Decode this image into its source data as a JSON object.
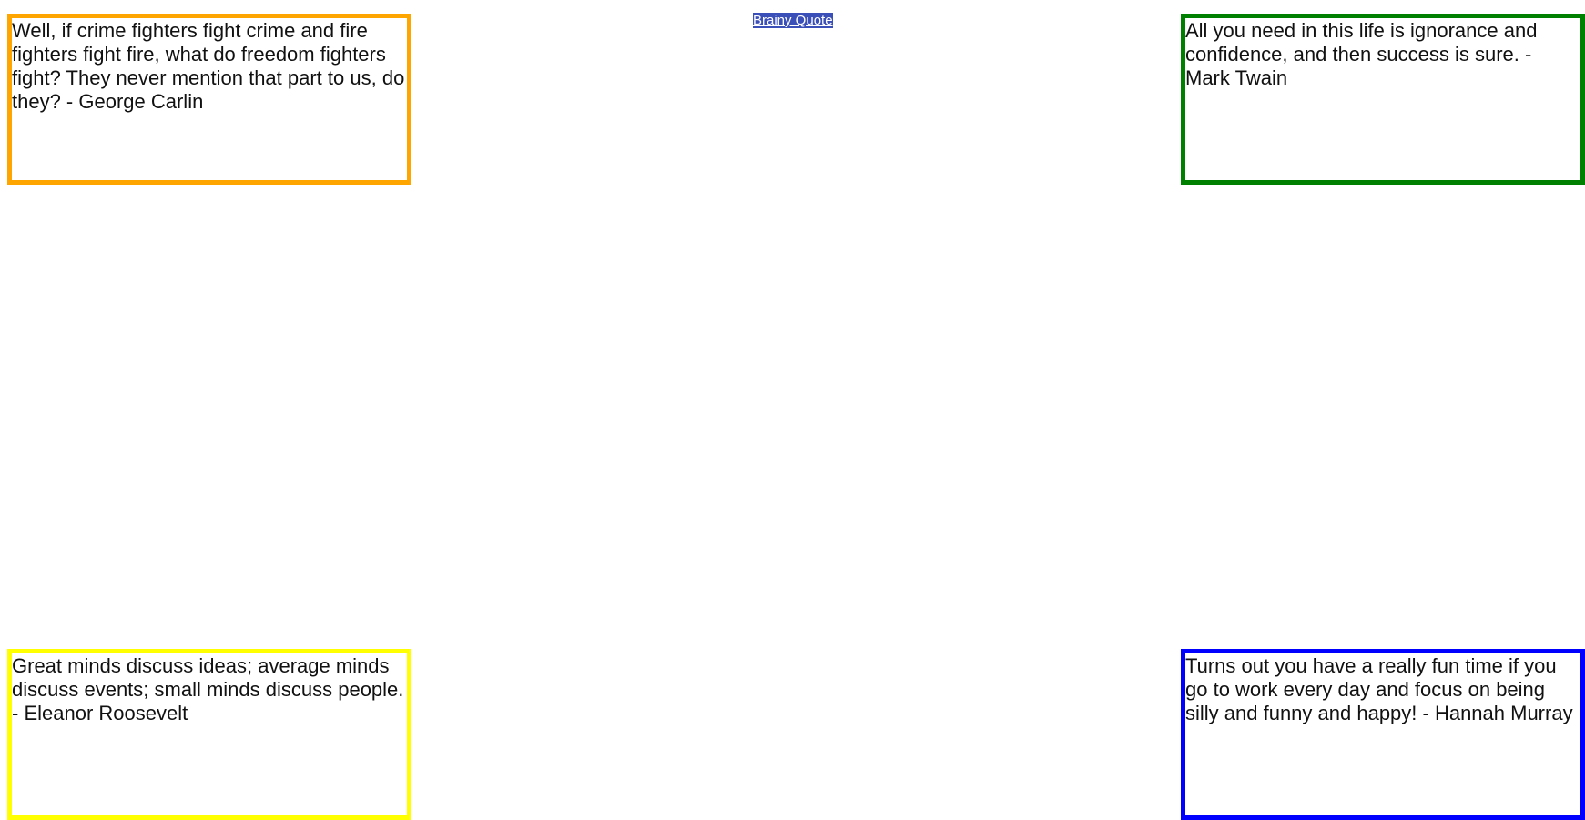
{
  "header": {
    "link_label": "Brainy Quote"
  },
  "quotes": [
    {
      "text": "Well, if crime fighters fight crime and fire fighters fight fire, what do freedom fighters fight? They never mention that part to us, do they? - George Carlin",
      "border_color": "#FFA500"
    },
    {
      "text": "All you need in this life is ignorance and confidence, and then success is sure. - Mark Twain",
      "border_color": "#008000"
    },
    {
      "text": "Great minds discuss ideas; average minds discuss events; small minds discuss people. - Eleanor Roosevelt",
      "border_color": "#FFFF00"
    },
    {
      "text": "Turns out you have a really fun time if you go to work every day and focus on being silly and funny and happy! - Hannah Murray",
      "border_color": "#0000FF"
    }
  ]
}
